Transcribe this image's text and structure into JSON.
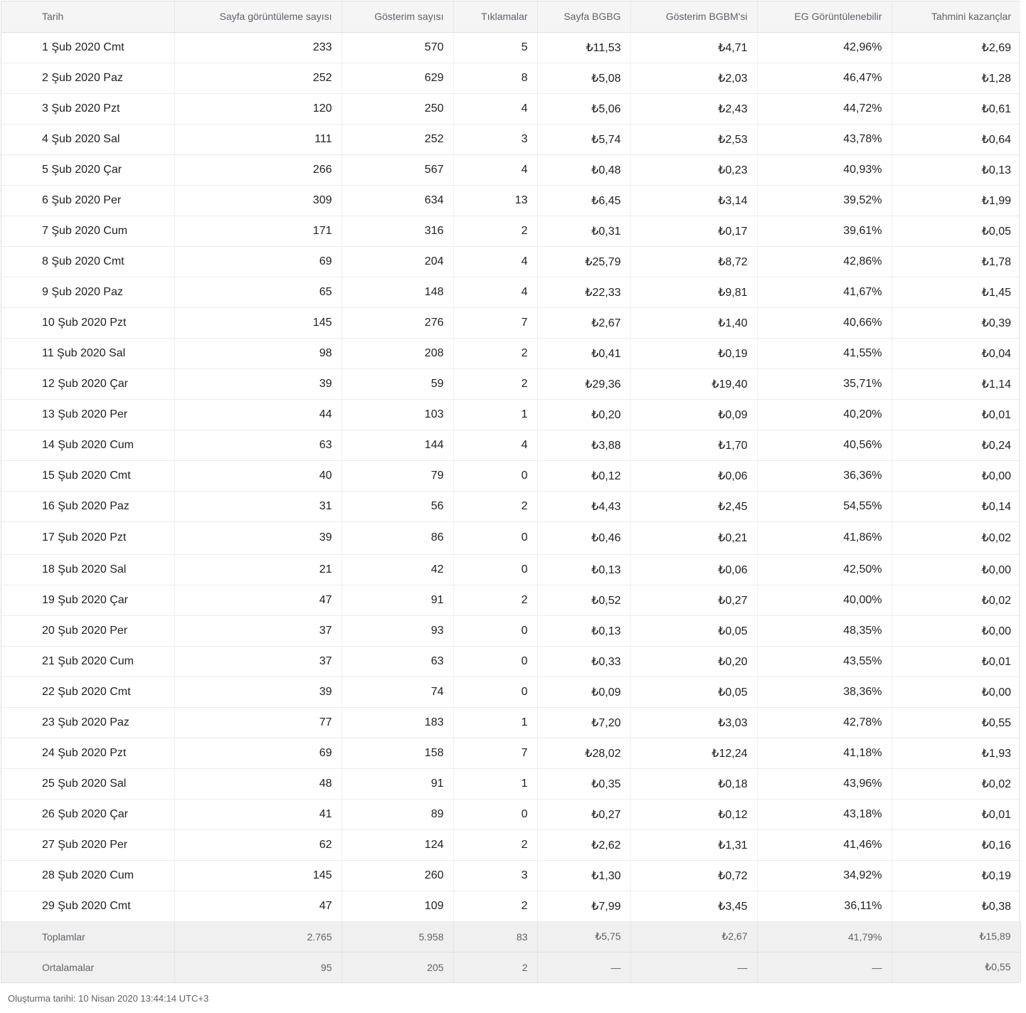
{
  "columns": [
    "Tarih",
    "Sayfa görüntüleme sayısı",
    "Gösterim sayısı",
    "Tıklamalar",
    "Sayfa BGBG",
    "Gösterim BGBM'si",
    "EG Görüntülenebilir",
    "Tahmini kazançlar"
  ],
  "rows": [
    [
      "1 Şub 2020 Cmt",
      "233",
      "570",
      "5",
      "₺11,53",
      "₺4,71",
      "42,96%",
      "₺2,69"
    ],
    [
      "2 Şub 2020 Paz",
      "252",
      "629",
      "8",
      "₺5,08",
      "₺2,03",
      "46,47%",
      "₺1,28"
    ],
    [
      "3 Şub 2020 Pzt",
      "120",
      "250",
      "4",
      "₺5,06",
      "₺2,43",
      "44,72%",
      "₺0,61"
    ],
    [
      "4 Şub 2020 Sal",
      "111",
      "252",
      "3",
      "₺5,74",
      "₺2,53",
      "43,78%",
      "₺0,64"
    ],
    [
      "5 Şub 2020 Çar",
      "266",
      "567",
      "4",
      "₺0,48",
      "₺0,23",
      "40,93%",
      "₺0,13"
    ],
    [
      "6 Şub 2020 Per",
      "309",
      "634",
      "13",
      "₺6,45",
      "₺3,14",
      "39,52%",
      "₺1,99"
    ],
    [
      "7 Şub 2020 Cum",
      "171",
      "316",
      "2",
      "₺0,31",
      "₺0,17",
      "39,61%",
      "₺0,05"
    ],
    [
      "8 Şub 2020 Cmt",
      "69",
      "204",
      "4",
      "₺25,79",
      "₺8,72",
      "42,86%",
      "₺1,78"
    ],
    [
      "9 Şub 2020 Paz",
      "65",
      "148",
      "4",
      "₺22,33",
      "₺9,81",
      "41,67%",
      "₺1,45"
    ],
    [
      "10 Şub 2020 Pzt",
      "145",
      "276",
      "7",
      "₺2,67",
      "₺1,40",
      "40,66%",
      "₺0,39"
    ],
    [
      "11 Şub 2020 Sal",
      "98",
      "208",
      "2",
      "₺0,41",
      "₺0,19",
      "41,55%",
      "₺0,04"
    ],
    [
      "12 Şub 2020 Çar",
      "39",
      "59",
      "2",
      "₺29,36",
      "₺19,40",
      "35,71%",
      "₺1,14"
    ],
    [
      "13 Şub 2020 Per",
      "44",
      "103",
      "1",
      "₺0,20",
      "₺0,09",
      "40,20%",
      "₺0,01"
    ],
    [
      "14 Şub 2020 Cum",
      "63",
      "144",
      "4",
      "₺3,88",
      "₺1,70",
      "40,56%",
      "₺0,24"
    ],
    [
      "15 Şub 2020 Cmt",
      "40",
      "79",
      "0",
      "₺0,12",
      "₺0,06",
      "36,36%",
      "₺0,00"
    ],
    [
      "16 Şub 2020 Paz",
      "31",
      "56",
      "2",
      "₺4,43",
      "₺2,45",
      "54,55%",
      "₺0,14"
    ],
    [
      "17 Şub 2020 Pzt",
      "39",
      "86",
      "0",
      "₺0,46",
      "₺0,21",
      "41,86%",
      "₺0,02"
    ],
    [
      "18 Şub 2020 Sal",
      "21",
      "42",
      "0",
      "₺0,13",
      "₺0,06",
      "42,50%",
      "₺0,00"
    ],
    [
      "19 Şub 2020 Çar",
      "47",
      "91",
      "2",
      "₺0,52",
      "₺0,27",
      "40,00%",
      "₺0,02"
    ],
    [
      "20 Şub 2020 Per",
      "37",
      "93",
      "0",
      "₺0,13",
      "₺0,05",
      "48,35%",
      "₺0,00"
    ],
    [
      "21 Şub 2020 Cum",
      "37",
      "63",
      "0",
      "₺0,33",
      "₺0,20",
      "43,55%",
      "₺0,01"
    ],
    [
      "22 Şub 2020 Cmt",
      "39",
      "74",
      "0",
      "₺0,09",
      "₺0,05",
      "38,36%",
      "₺0,00"
    ],
    [
      "23 Şub 2020 Paz",
      "77",
      "183",
      "1",
      "₺7,20",
      "₺3,03",
      "42,78%",
      "₺0,55"
    ],
    [
      "24 Şub 2020 Pzt",
      "69",
      "158",
      "7",
      "₺28,02",
      "₺12,24",
      "41,18%",
      "₺1,93"
    ],
    [
      "25 Şub 2020 Sal",
      "48",
      "91",
      "1",
      "₺0,35",
      "₺0,18",
      "43,96%",
      "₺0,02"
    ],
    [
      "26 Şub 2020 Çar",
      "41",
      "89",
      "0",
      "₺0,27",
      "₺0,12",
      "43,18%",
      "₺0,01"
    ],
    [
      "27 Şub 2020 Per",
      "62",
      "124",
      "2",
      "₺2,62",
      "₺1,31",
      "41,46%",
      "₺0,16"
    ],
    [
      "28 Şub 2020 Cum",
      "145",
      "260",
      "3",
      "₺1,30",
      "₺0,72",
      "34,92%",
      "₺0,19"
    ],
    [
      "29 Şub 2020 Cmt",
      "47",
      "109",
      "2",
      "₺7,99",
      "₺3,45",
      "36,11%",
      "₺0,38"
    ]
  ],
  "summary": [
    [
      "Toplamlar",
      "2.765",
      "5.958",
      "83",
      "₺5,75",
      "₺2,67",
      "41,79%",
      "₺15,89"
    ],
    [
      "Ortalamalar",
      "95",
      "205",
      "2",
      "—",
      "—",
      "—",
      "₺0,55"
    ]
  ],
  "footer": {
    "created": "Oluşturma tarihi: 10 Nisan 2020 13:44:14 UTC+3"
  },
  "colors": {
    "header_bg": "#f5f5f5",
    "summary_bg": "#f0f0f0",
    "text": "#202124",
    "muted": "#5f6368"
  }
}
